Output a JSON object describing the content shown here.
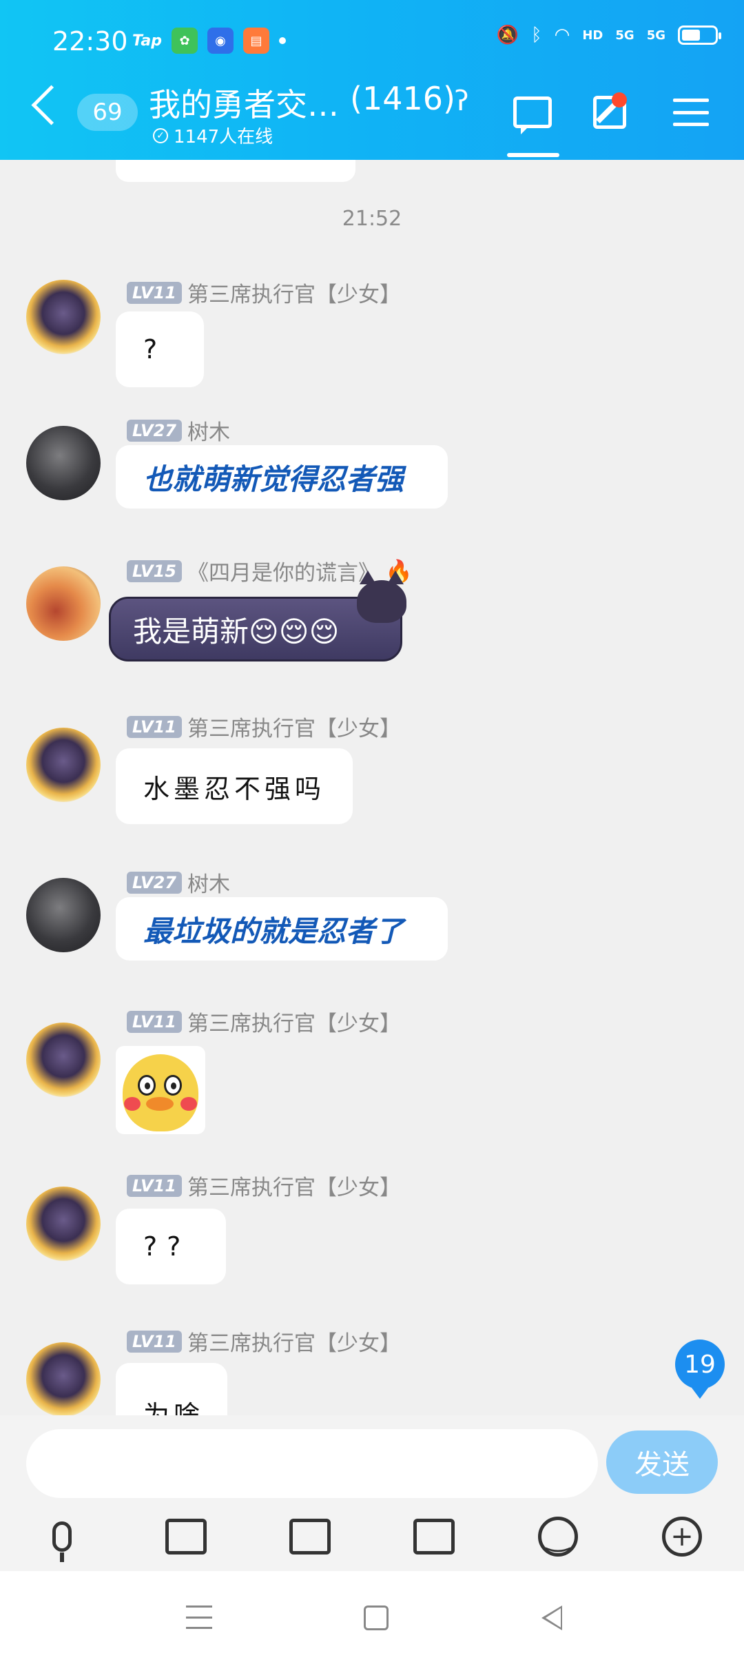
{
  "status_bar": {
    "time": "22:30",
    "apps": [
      "Tap"
    ],
    "network_labels": [
      "HD",
      "5G",
      "5G"
    ],
    "battery_level": 0.5
  },
  "header": {
    "unread_count": "69",
    "group_title": "我的勇者交…",
    "member_count": "(1416)",
    "online_text": "1147人在线",
    "ear_icon": "ear-icon",
    "brand_gradient": [
      "#11c5f4",
      "#14a3f4"
    ]
  },
  "chat": {
    "timestamp": "21:52",
    "messages": [
      {
        "level": "LV11",
        "name": "第三席执行官【少女】",
        "text": "?"
      },
      {
        "level": "LV27",
        "name": "树木",
        "text": "也就萌新觉得忍者强"
      },
      {
        "level": "LV15",
        "name": "《四月是你的谎言》",
        "text": "我是萌新😌😌😌"
      },
      {
        "level": "LV11",
        "name": "第三席执行官【少女】",
        "text": "水墨忍不强吗"
      },
      {
        "level": "LV27",
        "name": "树木",
        "text": "最垃圾的就是忍者了"
      },
      {
        "level": "LV11",
        "name": "第三席执行官【少女】",
        "sticker": "duck-sticker"
      },
      {
        "level": "LV11",
        "name": "第三席执行官【少女】",
        "text": "??"
      },
      {
        "level": "LV11",
        "name": "第三席执行官【少女】",
        "text": "为啥"
      }
    ],
    "new_message_badge": "19"
  },
  "input": {
    "placeholder": "",
    "send_label": "发送"
  }
}
